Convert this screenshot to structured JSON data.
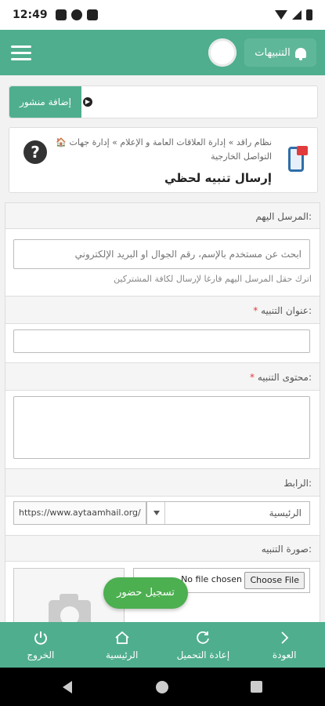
{
  "status": {
    "time": "12:49"
  },
  "header": {
    "notifications_label": "التنبيهات"
  },
  "add_post": {
    "label": "إضافة منشور"
  },
  "breadcrumb": {
    "line1": "🏠 نظام راقد » إدارة العلاقات العامة و الإعلام » إدارة جهات",
    "line2": "التواصل الخارجية",
    "title": "إرسال تنبيه لحظي"
  },
  "form": {
    "recipients_label": "المرسل اليهم:",
    "recipients_placeholder": "ابحث عن مستخدم بالإسم، رقم الجوال او البريد الإلكتروني",
    "recipients_hint": "اترك حقل المرسل اليهم فارغا لإرسال لكافة المشتركين",
    "title_label": "عنوان التنبيه:",
    "title_required": "*",
    "content_label": "محتوى التنبيه:",
    "content_required": "*",
    "link_label": "الرابط:",
    "link_select_value": "الرئيسية",
    "link_url": "https://www.aytaamhail.org/",
    "image_label": "صورة التنبيه:",
    "choose_file": "Choose File",
    "no_file": "No file chosen"
  },
  "fab": {
    "label": "تسجيل حضور"
  },
  "bottom_nav": {
    "logout": "الخروج",
    "home": "الرئيسية",
    "reload": "إعادة التحميل",
    "back": "العودة"
  }
}
